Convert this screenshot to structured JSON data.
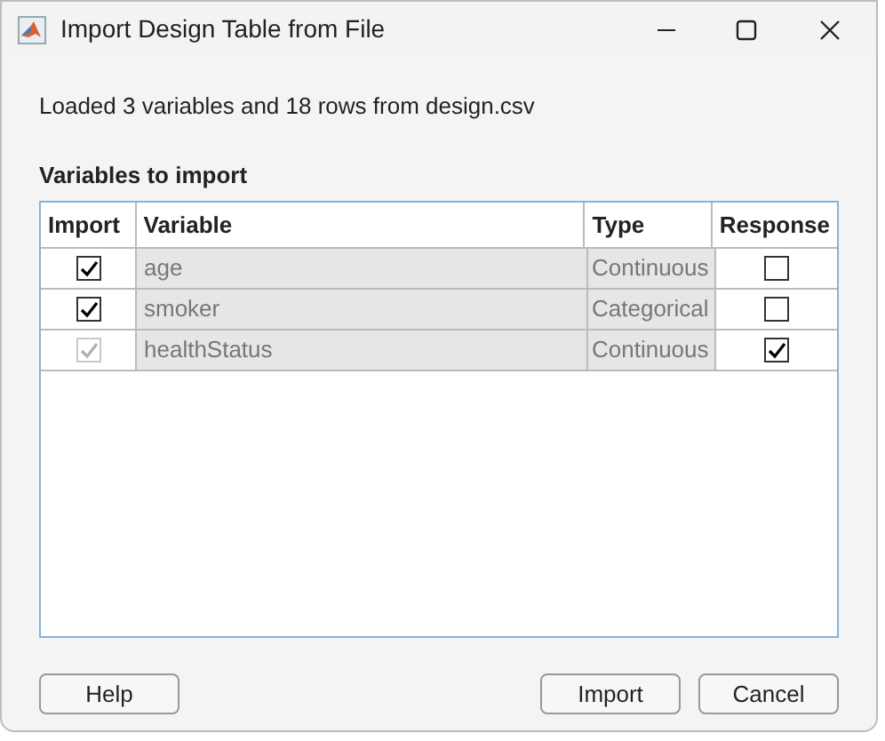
{
  "window": {
    "title": "Import Design Table from File"
  },
  "message": "Loaded 3 variables and 18 rows from design.csv",
  "section_title": "Variables to import",
  "table": {
    "columns": [
      "Import",
      "Variable",
      "Type",
      "Response"
    ],
    "rows": [
      {
        "import_checked": true,
        "import_disabled": false,
        "variable": "age",
        "type": "Continuous",
        "response_checked": false
      },
      {
        "import_checked": true,
        "import_disabled": false,
        "variable": "smoker",
        "type": "Categorical",
        "response_checked": false
      },
      {
        "import_checked": true,
        "import_disabled": true,
        "variable": "healthStatus",
        "type": "Continuous",
        "response_checked": true
      }
    ]
  },
  "buttons": {
    "left": [
      "Help"
    ],
    "right": [
      "Import",
      "Cancel"
    ]
  }
}
